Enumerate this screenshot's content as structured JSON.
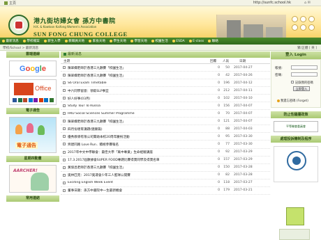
{
  "topbar": {
    "home": "主頁",
    "url": "http://sunfc.school.hk"
  },
  "header": {
    "school_cn": "港九街坊婦女會 孫方中書院",
    "school_assoc": "H.K. & Kowloon Kaifong Women's Association",
    "school_en": "SUN FONG CHUNG COLLEGE"
  },
  "nav": [
    "最新消息",
    "學校檔案",
    "新生入學",
    "教職員天地",
    "家長天地",
    "學生天地",
    "學習天地",
    "校園生活",
    "ESDA",
    "E-class",
    "聯絡"
  ],
  "crumb": "學校/School > 最新消息",
  "lang": "繁/正體 [ 英 ]",
  "left": {
    "links_title": "雲端連線",
    "google": "Google",
    "office": "Office",
    "enotice_title": "電子通告",
    "enotice_text": "電子通告",
    "week_title": "星期四動畫",
    "week_text": "AARCHER!",
    "more_title": "常用連結"
  },
  "center": {
    "title": "最新消息",
    "headers": {
      "topic": "主題",
      "reply": "回覆",
      "views": "人氣",
      "date": "日期"
    },
    "rows": [
      {
        "t": "陳翠嫻老師於香港三九數賽「校園生活」",
        "r": "0",
        "v": "50",
        "d": "2017-04-27"
      },
      {
        "t": "陳翠嫻老師於香港三九數賽「校園生活」",
        "r": "0",
        "v": "42",
        "d": "2017-04-26"
      },
      {
        "t": "S6 Oral Exam Timetable",
        "r": "0",
        "v": "196",
        "d": "2017-04-12"
      },
      {
        "t": "中六同學留意：領取SLP事宜",
        "r": "0",
        "v": "212",
        "d": "2017-04-11"
      },
      {
        "t": "好人好事(03月)",
        "r": "0",
        "v": "102",
        "d": "2017-04-10"
      },
      {
        "t": "Study Tour To Russia",
        "r": "0",
        "v": "156",
        "d": "2017-04-07"
      },
      {
        "t": "HKU Social Sciences Summer Programme",
        "r": "0",
        "v": "70",
        "d": "2017-04-07"
      },
      {
        "t": "陳翠嫻老師於香港三九數賽「校園生活」",
        "r": "0",
        "v": "121",
        "d": "2017-04-07"
      },
      {
        "t": "四月份德育講題(健康篇)",
        "r": "0",
        "v": "88",
        "d": "2017-04-03"
      },
      {
        "t": "優秀教導有限公司贊助本校20周年慶祝活動",
        "r": "0",
        "v": "95",
        "d": "2017-03-30"
      },
      {
        "t": "齊建同路 Love Run．積極參賽報名",
        "r": "0",
        "v": "77",
        "d": "2017-03-30"
      },
      {
        "t": "2017年中文中學聯會：最佳大學「萬中專業」生命經驗講座",
        "r": "0",
        "v": "92",
        "d": "2017-03-29"
      },
      {
        "t": "17.3.2017屆數據會SUPER FOOD專題比賽得獎同學及得獎名單",
        "r": "0",
        "v": "157",
        "d": "2017-03-29"
      },
      {
        "t": "黃偉昌老師於香港三九數賽「校園生活」",
        "r": "0",
        "v": "150",
        "d": "2017-03-28"
      },
      {
        "t": "奧林匹克：2017奧運會少年三人籃球公開賽",
        "r": "0",
        "v": "82",
        "d": "2017-03-28"
      },
      {
        "t": "Exciting English Week Event",
        "r": "0",
        "v": "118",
        "d": "2017-03-27"
      },
      {
        "t": "董事日期：孫方中書院中一生最新機會",
        "r": "0",
        "v": "179",
        "d": "2017-03-21"
      }
    ]
  },
  "right": {
    "login_title": "登入 Login",
    "user_label": "帳號:",
    "pass_label": "密碼:",
    "remember": "記錄我的密碼",
    "login_btn": "立即登入",
    "forgot": "我遺忘密碼 (Forget)",
    "anti_title": "防止性騷擾政策",
    "anti_text": "平等機會委員會",
    "policy_title": "處理投訴機制及程序"
  },
  "colors": {
    "nav": "#2f6a1c",
    "accent": "#a9c972",
    "brand": "#1e5a1e"
  }
}
